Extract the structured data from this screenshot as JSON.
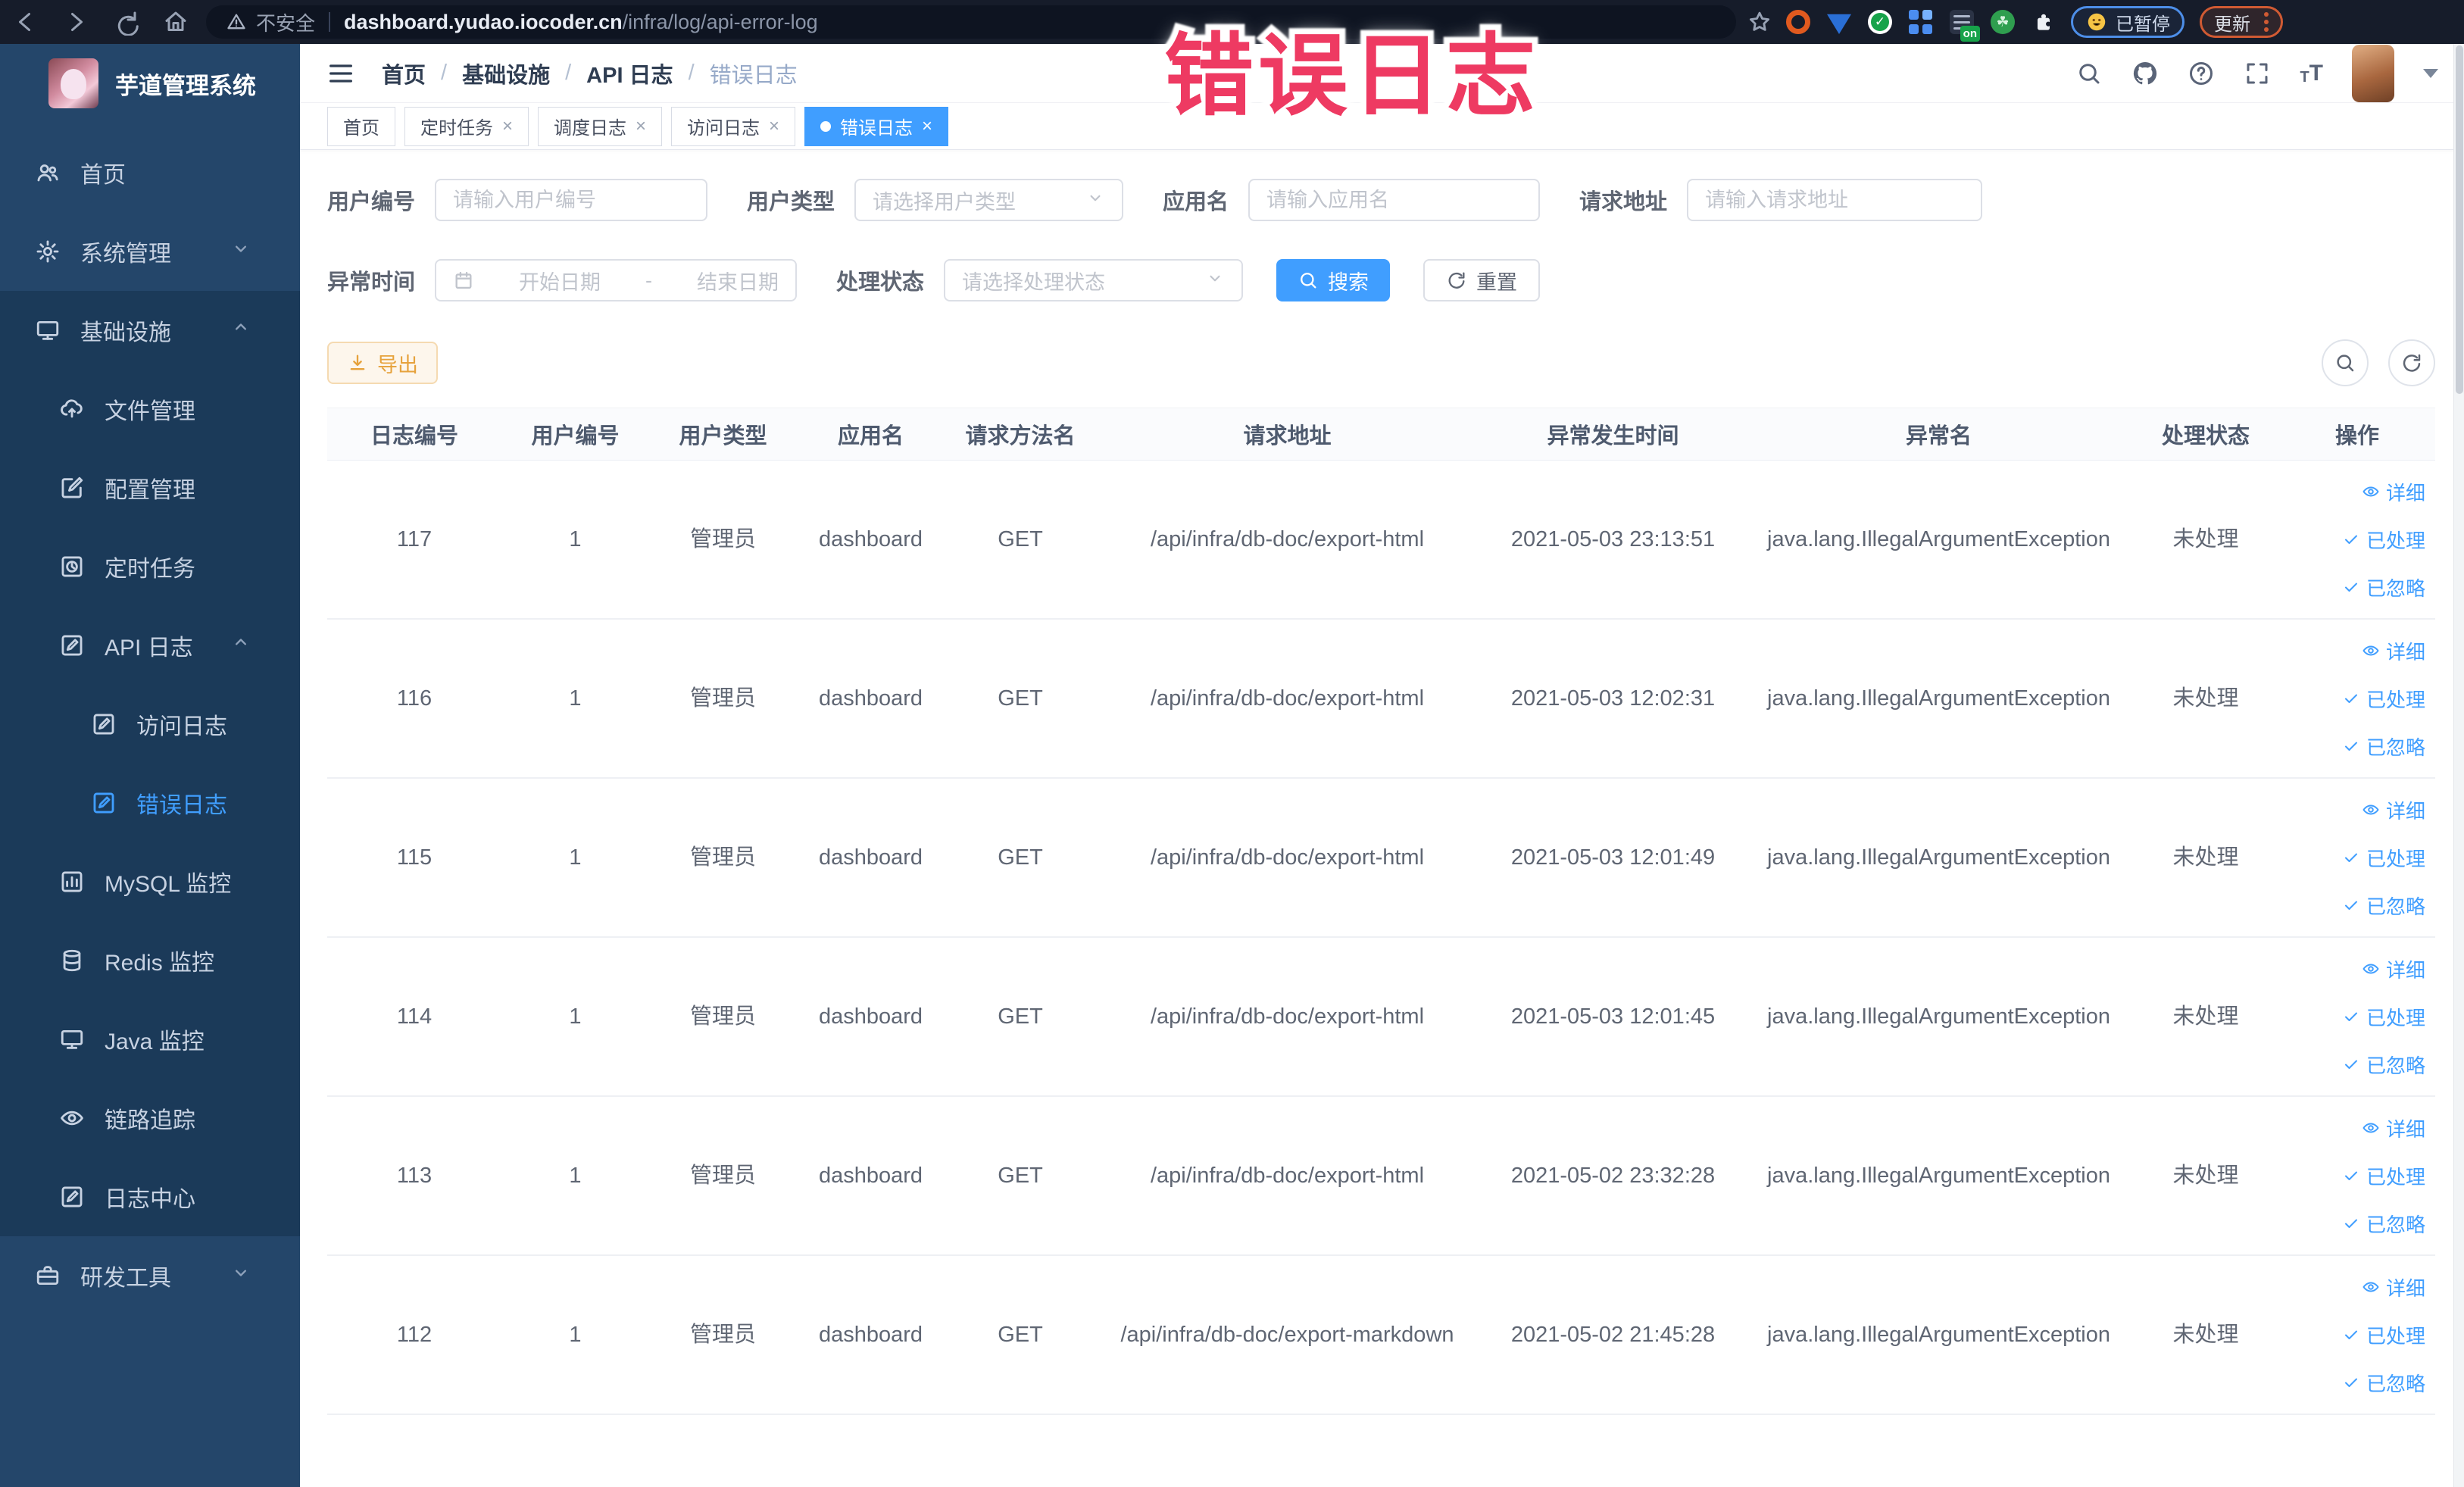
{
  "overlay": {
    "text": "错误日志"
  },
  "browser": {
    "security_label": "不安全",
    "url_domain": "dashboard.yudao.iocoder.cn",
    "url_path": "/infra/log/api-error-log",
    "paused_badge": "已暂停",
    "update_badge": "更新",
    "on_badge": "on"
  },
  "sidebar": {
    "logo_title": "芋道管理系统",
    "items": {
      "home": "首页",
      "system": "系统管理",
      "infra": "基础设施",
      "file": "文件管理",
      "config": "配置管理",
      "job": "定时任务",
      "api_log": "API 日志",
      "access_log": "访问日志",
      "error_log": "错误日志",
      "mysql": "MySQL 监控",
      "redis": "Redis 监控",
      "java": "Java 监控",
      "trace": "链路追踪",
      "log_center": "日志中心",
      "dev_tools": "研发工具"
    }
  },
  "navbar": {
    "breadcrumb": [
      "首页",
      "基础设施",
      "API 日志",
      "错误日志"
    ],
    "separator": "/"
  },
  "tabs": [
    {
      "label": "首页"
    },
    {
      "label": "定时任务"
    },
    {
      "label": "调度日志"
    },
    {
      "label": "访问日志"
    },
    {
      "label": "错误日志"
    }
  ],
  "filters": {
    "user_id_label": "用户编号",
    "user_id_placeholder": "请输入用户编号",
    "user_type_label": "用户类型",
    "user_type_placeholder": "请选择用户类型",
    "app_name_label": "应用名",
    "app_name_placeholder": "请输入应用名",
    "request_url_label": "请求地址",
    "request_url_placeholder": "请输入请求地址",
    "time_label": "异常时间",
    "time_start_placeholder": "开始日期",
    "time_separator": "-",
    "time_end_placeholder": "结束日期",
    "status_label": "处理状态",
    "status_placeholder": "请选择处理状态",
    "search_button": "搜索",
    "reset_button": "重置"
  },
  "toolbar": {
    "export_button": "导出"
  },
  "table": {
    "headers": {
      "h1": "日志编号",
      "h2": "用户编号",
      "h3": "用户类型",
      "h4": "应用名",
      "h5": "请求方法名",
      "h6": "请求地址",
      "h7": "异常发生时间",
      "h8": "异常名",
      "h9": "处理状态",
      "h10": "操作"
    },
    "actions": {
      "detail": "详细",
      "processed": "已处理",
      "ignored": "已忽略"
    },
    "rows": [
      {
        "id": "117",
        "user_id": "1",
        "user_type": "管理员",
        "app": "dashboard",
        "method": "GET",
        "url": "/api/infra/db-doc/export-html",
        "time": "2021-05-03 23:13:51",
        "exception": "java.lang.IllegalArgumentException",
        "status": "未处理"
      },
      {
        "id": "116",
        "user_id": "1",
        "user_type": "管理员",
        "app": "dashboard",
        "method": "GET",
        "url": "/api/infra/db-doc/export-html",
        "time": "2021-05-03 12:02:31",
        "exception": "java.lang.IllegalArgumentException",
        "status": "未处理"
      },
      {
        "id": "115",
        "user_id": "1",
        "user_type": "管理员",
        "app": "dashboard",
        "method": "GET",
        "url": "/api/infra/db-doc/export-html",
        "time": "2021-05-03 12:01:49",
        "exception": "java.lang.IllegalArgumentException",
        "status": "未处理"
      },
      {
        "id": "114",
        "user_id": "1",
        "user_type": "管理员",
        "app": "dashboard",
        "method": "GET",
        "url": "/api/infra/db-doc/export-html",
        "time": "2021-05-03 12:01:45",
        "exception": "java.lang.IllegalArgumentException",
        "status": "未处理"
      },
      {
        "id": "113",
        "user_id": "1",
        "user_type": "管理员",
        "app": "dashboard",
        "method": "GET",
        "url": "/api/infra/db-doc/export-html",
        "time": "2021-05-02 23:32:28",
        "exception": "java.lang.IllegalArgumentException",
        "status": "未处理"
      },
      {
        "id": "112",
        "user_id": "1",
        "user_type": "管理员",
        "app": "dashboard",
        "method": "GET",
        "url": "/api/infra/db-doc/export-markdown",
        "time": "2021-05-02 21:45:28",
        "exception": "java.lang.IllegalArgumentException",
        "status": "未处理"
      }
    ]
  },
  "colors": {
    "accent": "#409eff",
    "warning": "#e6a23c",
    "overlay_pink": "#ee3a62",
    "sidebar_base": "#24466a",
    "sidebar_panel": "#1b3a59",
    "chrome_dark": "#161c2a"
  }
}
